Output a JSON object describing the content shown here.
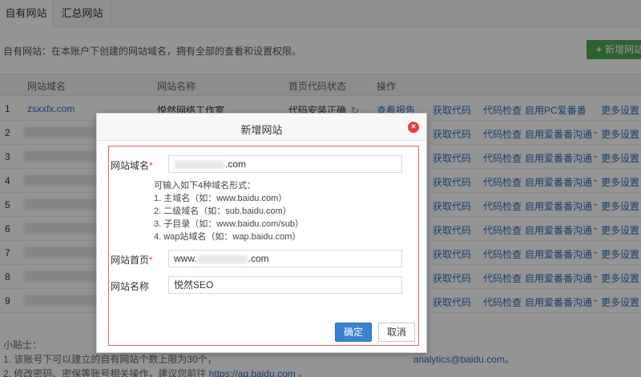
{
  "tabs": [
    {
      "label": "自有网站"
    },
    {
      "label": "汇总网站"
    }
  ],
  "description": "自有网站：在本账户下创建的网站域名，拥有全部的查看和设置权限。",
  "add_button": {
    "icon": "plus-icon",
    "label": "新增网站"
  },
  "table": {
    "headers": [
      "网站域名",
      "网站名称",
      "首页代码状态",
      "操作"
    ],
    "rows": [
      {
        "index": "1",
        "domain": "zsxxfx.com",
        "name": "悦然网络工作室",
        "status": "代码安装正确",
        "actions": [
          "查看报告",
          "获取代码",
          "代码检查",
          "启用PC爱番番",
          "更多设置"
        ]
      },
      {
        "index": "2",
        "actions": [
          "获取代码",
          "代码检查",
          "启用爱番番沟通",
          "更多设置"
        ]
      },
      {
        "index": "3",
        "actions": [
          "获取代码",
          "代码检查",
          "启用爱番番沟通",
          "更多设置"
        ]
      },
      {
        "index": "4",
        "actions": [
          "获取代码",
          "代码检查",
          "启用爱番番沟通",
          "更多设置"
        ]
      },
      {
        "index": "5",
        "actions": [
          "获取代码",
          "代码检查",
          "启用爱番番沟通",
          "更多设置"
        ]
      },
      {
        "index": "6",
        "actions": [
          "获取代码",
          "代码检查",
          "启用爱番番沟通",
          "更多设置"
        ]
      },
      {
        "index": "7",
        "actions": [
          "获取代码",
          "代码检查",
          "启用爱番番沟通",
          "更多设置"
        ]
      },
      {
        "index": "8",
        "actions": [
          "获取代码",
          "代码检查",
          "启用爱番番沟通",
          "更多设置"
        ]
      },
      {
        "index": "9",
        "actions": [
          "获取代码",
          "代码检查",
          "启用爱番番沟通",
          "更多设置"
        ]
      }
    ]
  },
  "tips": {
    "title": "小贴士：",
    "line1_prefix": "1. 该账号下可以建立的自有网站个数上限为30个，",
    "line1_link": "analytics@baidu.com",
    "line1_suffix": "。",
    "line2_prefix": "2. 修改密码、密保等账号相关操作，建议您前往 ",
    "line2_link": "https://aq.baidu.com",
    "line2_suffix": " 。"
  },
  "modal": {
    "title": "新增网站",
    "domain_label": "网站域名",
    "domain_value_suffix": ".com",
    "hint_lines": [
      "可输入如下4种域名形式：",
      "1. 主域名（如：www.baidu.com）",
      "2. 二级域名（如：sub.baidu.com）",
      "3. 子目录（如：www.baidu.com/sub）",
      "4. wap站域名（如：wap.baidu.com）"
    ],
    "home_label": "网站首页",
    "home_value_prefix": "www.",
    "home_value_suffix": ".com",
    "name_label": "网站名称",
    "name_value": "悦然SEO",
    "ok_label": "确定",
    "cancel_label": "取消"
  },
  "colors": {
    "accent": "#3a81d2",
    "add_button": "#4caa54",
    "link": "#2b6fc2",
    "close": "#e1423f",
    "frame_border": "#e06060"
  }
}
